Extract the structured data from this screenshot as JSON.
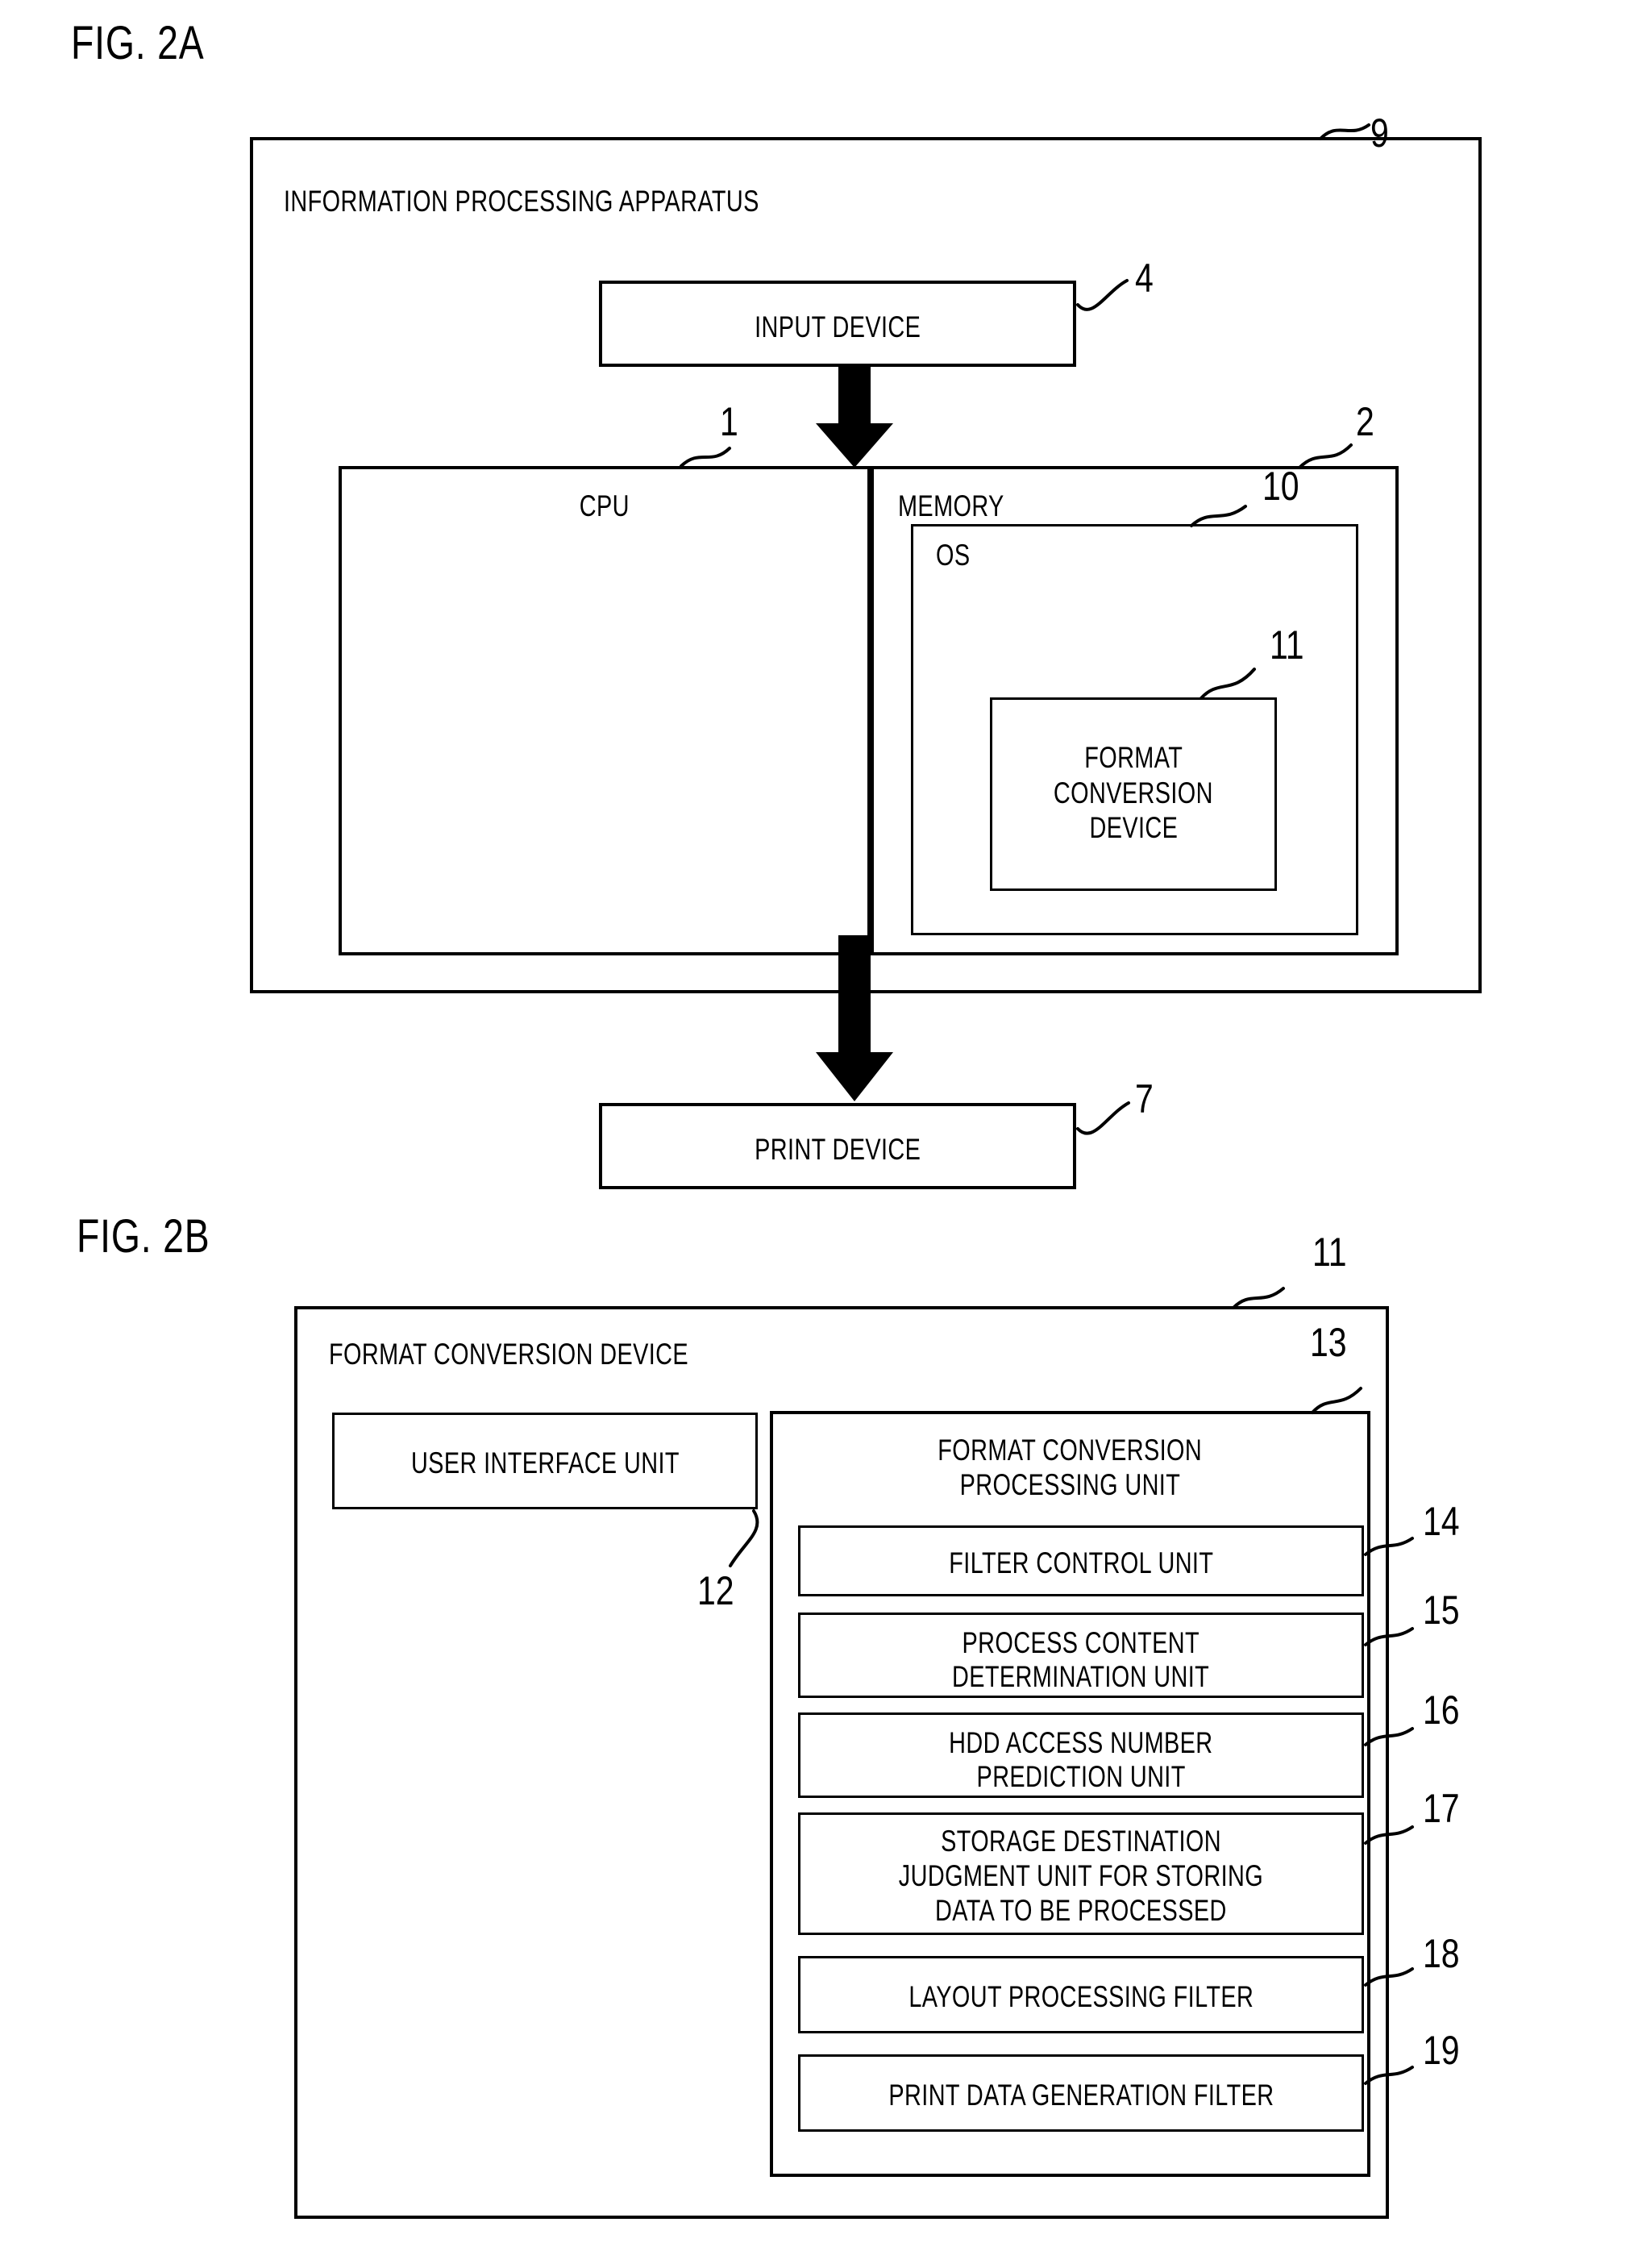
{
  "figures": [
    {
      "id": "fig2a",
      "label": "FIG. 2A",
      "outer": {
        "title": "INFORMATION PROCESSING APPARATUS",
        "ref": "9"
      },
      "input_device": {
        "label": "INPUT DEVICE",
        "ref": "4"
      },
      "cpu": {
        "label": "CPU",
        "ref": "1"
      },
      "memory": {
        "label": "MEMORY",
        "ref": "2"
      },
      "os": {
        "label": "OS",
        "ref": "10"
      },
      "format_conversion_device": {
        "line1": "FORMAT",
        "line2": "CONVERSION",
        "line3": "DEVICE",
        "ref": "11"
      },
      "print_device": {
        "label": "PRINT DEVICE",
        "ref": "7"
      }
    },
    {
      "id": "fig2b",
      "label": "FIG. 2B",
      "outer": {
        "title": "FORMAT CONVERSION DEVICE",
        "ref": "11"
      },
      "user_interface_unit": {
        "label": "USER INTERFACE UNIT",
        "ref": "12"
      },
      "format_conversion_processing_unit": {
        "line1": "FORMAT CONVERSION",
        "line2": "PROCESSING UNIT",
        "ref": "13"
      },
      "units": [
        {
          "lines": [
            "FILTER CONTROL UNIT"
          ],
          "ref": "14"
        },
        {
          "lines": [
            "PROCESS CONTENT",
            "DETERMINATION UNIT"
          ],
          "ref": "15"
        },
        {
          "lines": [
            "HDD ACCESS NUMBER",
            "PREDICTION UNIT"
          ],
          "ref": "16"
        },
        {
          "lines": [
            "STORAGE DESTINATION",
            "JUDGMENT UNIT FOR STORING",
            "DATA TO BE PROCESSED"
          ],
          "ref": "17"
        },
        {
          "lines": [
            "LAYOUT PROCESSING FILTER"
          ],
          "ref": "18"
        },
        {
          "lines": [
            "PRINT DATA GENERATION FILTER"
          ],
          "ref": "19"
        }
      ]
    }
  ],
  "colors": {
    "ink": "#000000",
    "paper": "#ffffff"
  }
}
